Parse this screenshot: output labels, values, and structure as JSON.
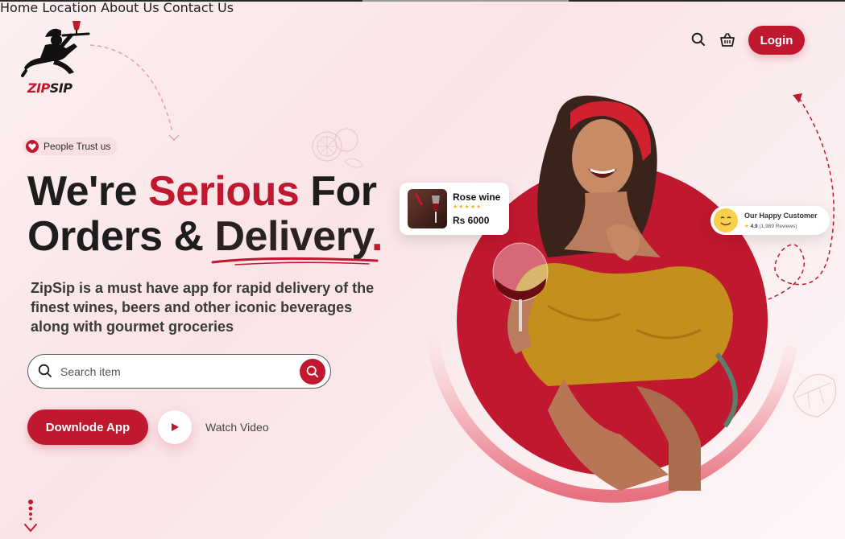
{
  "brand": {
    "name_red": "ZIP",
    "name_dark": "SIP"
  },
  "nav": {
    "items": [
      "Home",
      "Location",
      "About Us",
      "Contact Us"
    ],
    "login_label": "Login"
  },
  "icons": {
    "search": "search-icon",
    "cart": "basket-icon",
    "heart": "heart-icon",
    "play": "play-icon"
  },
  "hero": {
    "badge": "People Trust us",
    "headline_line1_a": "We're ",
    "headline_line1_red": "Serious",
    "headline_line1_b": " For",
    "headline_line2_a": "Orders & ",
    "headline_line2_dark": "Delivery",
    "headline_dot": ".",
    "description": "ZipSip is a must have app for rapid delivery of the finest wines, beers and other iconic beverages along with gourmet groceries",
    "search_placeholder": "Search item",
    "download_label": "Downlode App",
    "watch_label": "Watch Video"
  },
  "product_card": {
    "name": "Rose wine",
    "stars": "★★★★★",
    "price": "Rs 6000"
  },
  "review_card": {
    "title": "Our Happy Customer",
    "rating": "4.9",
    "reviews": "(1,989 Reviews)",
    "star": "★"
  },
  "colors": {
    "accent": "#c0182e",
    "background": "#fbeef0",
    "text": "#1d1d1d"
  }
}
